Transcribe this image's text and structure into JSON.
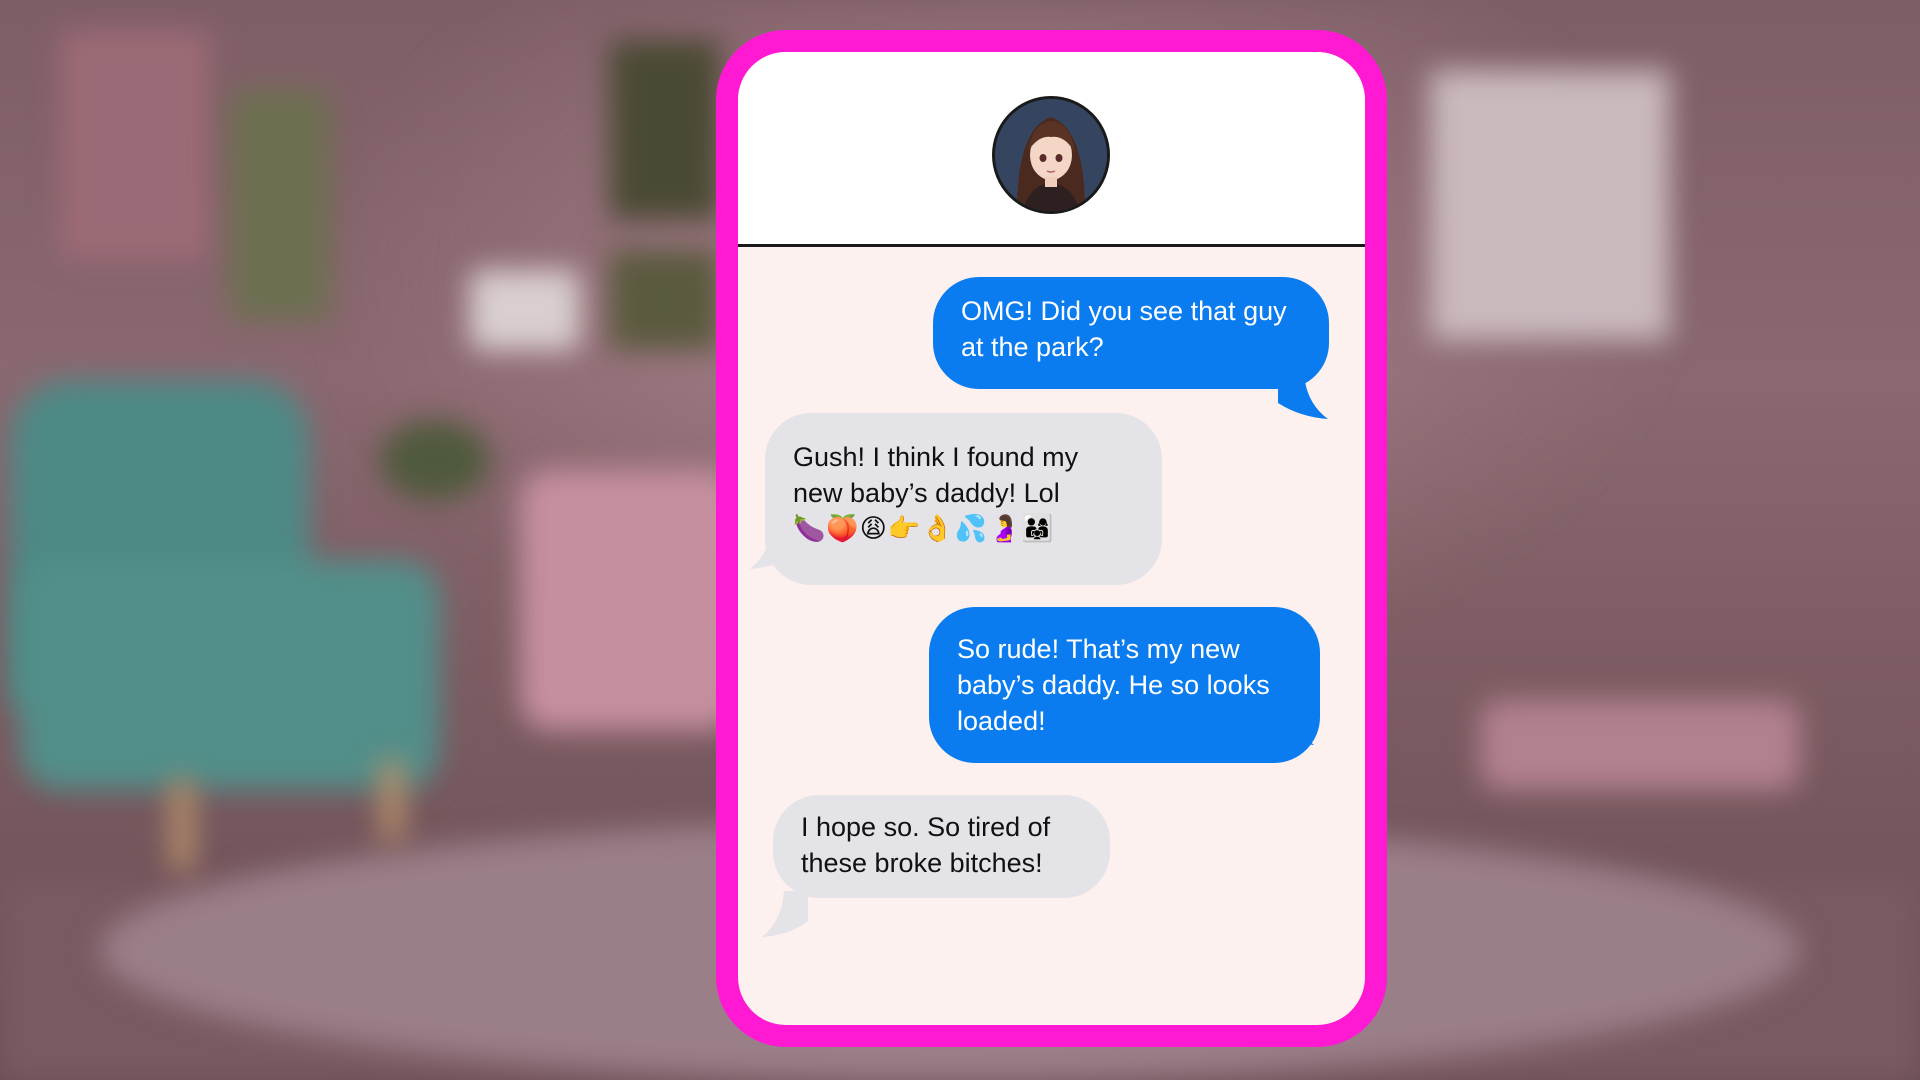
{
  "chat": {
    "contact_avatar_icon": "anime-girl-avatar",
    "accent_color": "#ff19d3",
    "sent_color": "#0a7cf0",
    "received_color": "#e4e3e8",
    "messages": [
      {
        "direction": "sent",
        "text": "OMG! Did you see that guy at the park?"
      },
      {
        "direction": "received",
        "text": "Gush! I think I found my new baby’s daddy! Lol",
        "emoji": "🍆🍑😩👉👌💦🤰👨‍👩‍👧"
      },
      {
        "direction": "sent",
        "text": "So rude! That’s my new baby’s daddy. He so looks loaded!"
      },
      {
        "direction": "received",
        "text": "I hope so. So tired of these broke bitches!"
      }
    ]
  }
}
